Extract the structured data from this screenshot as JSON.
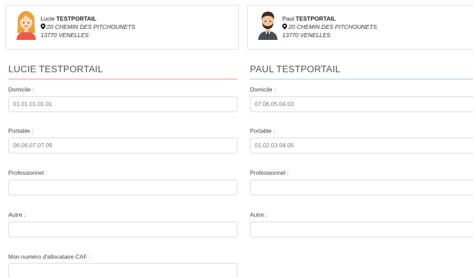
{
  "people": [
    {
      "first_name": "Lucie",
      "last_name": "TESTPORTAIL",
      "address_line1": "20 CHEMIN DES PITCHOUNETS",
      "address_line2": "13770 VENELLES",
      "avatar_icon": "woman-avatar-icon",
      "section_title": "LUCIE TESTPORTAIL",
      "accent_color": "#f0c7cb"
    },
    {
      "first_name": "Paul",
      "last_name": "TESTPORTAIL",
      "address_line1": "20 CHEMIN DES PITCHOUNETS",
      "address_line2": "13770 VENELLES",
      "avatar_icon": "man-avatar-icon",
      "section_title": "PAUL TESTPORTAIL",
      "accent_color": "#cfe4ef"
    }
  ],
  "labels": {
    "domicile": "Domicile :",
    "portable": "Portable :",
    "professionnel": "Professionnel :",
    "autre": "Autre :",
    "caf": "Mon numéro d'allocataire CAF :"
  },
  "fields": {
    "lucie": {
      "domicile": "01.01.01.01.01",
      "portable": "06.06.07.07.09",
      "professionnel": "",
      "autre": "",
      "caf": ""
    },
    "paul": {
      "domicile": "07.06.05.04.03",
      "portable": "01.02.03.04.05",
      "professionnel": "",
      "autre": ""
    }
  }
}
